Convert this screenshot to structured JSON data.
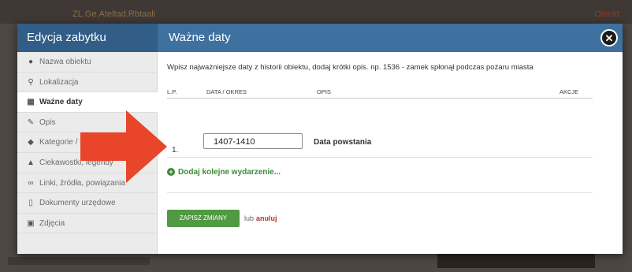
{
  "background": {
    "top_link": "ZL.Ge.Ateltad.Rbtaali",
    "top_right": "Obiekt"
  },
  "modal": {
    "sidebar_title": "Edycja zabytku",
    "title": "Ważne daty",
    "close_icon": "close-icon"
  },
  "sidebar": {
    "items": [
      {
        "icon": "info-icon",
        "glyph": "●",
        "label": "Nazwa obiektu"
      },
      {
        "icon": "pin-icon",
        "glyph": "⚲",
        "label": "Lokalizacja"
      },
      {
        "icon": "calendar-icon",
        "glyph": "▦",
        "label": "Ważne daty"
      },
      {
        "icon": "edit-icon",
        "glyph": "✎",
        "label": "Opis"
      },
      {
        "icon": "tag-icon",
        "glyph": "◆",
        "label": "Kategorie / tagi"
      },
      {
        "icon": "landscape-icon",
        "glyph": "▲",
        "label": "Ciekawostki, legendy"
      },
      {
        "icon": "link-icon",
        "glyph": "∞",
        "label": "Linki, źródła, powiązania"
      },
      {
        "icon": "document-icon",
        "glyph": "▯",
        "label": "Dokumenty urzędowe"
      },
      {
        "icon": "image-icon",
        "glyph": "▣",
        "label": "Zdjęcia"
      }
    ]
  },
  "content": {
    "intro": "Wpisz najważniejsze daty z historii obiektu, dodaj krótki opis. np. 1536 - zamek spłonął podczas pożaru miasta",
    "columns": {
      "num": "L.P.",
      "date": "DATA / OKRES",
      "desc": "OPIS",
      "actions": "AKCJE"
    },
    "rows": [
      {
        "num": "1.",
        "date": "1407-1410",
        "desc": "Data powstania"
      }
    ],
    "add_label": "Dodaj kolejne wydarzenie...",
    "save_label": "ZAPISZ ZMIANY",
    "or_label": "lub",
    "cancel_label": "anuluj"
  },
  "colors": {
    "sidebar_header": "#315d86",
    "main_header": "#3e70a0",
    "save_button": "#4f9a43",
    "arrow": "#e8452a"
  }
}
